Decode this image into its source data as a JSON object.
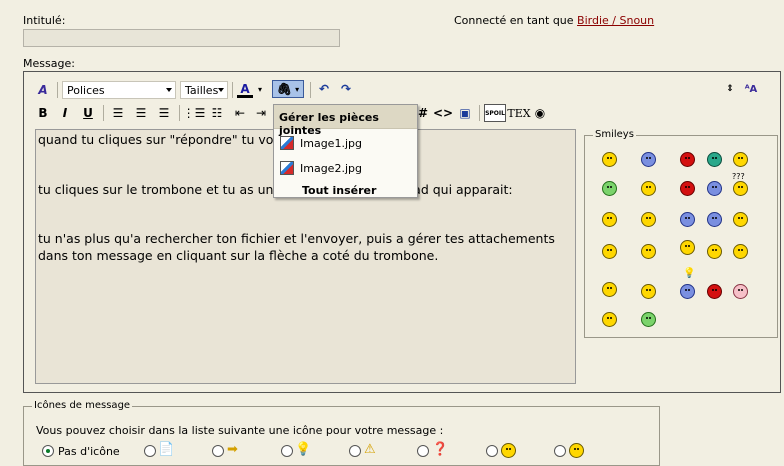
{
  "form": {
    "title_label": "Intitulé:",
    "message_label": "Message:",
    "title_value": ""
  },
  "header": {
    "connected_prefix": "Connecté en tant que",
    "user_link": "Birdie / Snoun"
  },
  "toolbar": {
    "font_select": "Polices",
    "size_select": "Tailles",
    "bold": "B",
    "italic": "I",
    "underline": "U",
    "code_label": "<>",
    "tex_label": "TEX",
    "spoil_label": "SPOIL"
  },
  "editor": {
    "lines": [
      "quand tu cliques sur \"répondre\" tu vo",
      "",
      "",
      "tu cliques sur le trombone et tu as une petite fenêtre d'upload qui apparait:",
      "",
      "",
      "tu n'as plus qu'a rechercher ton fichier et l'envoyer, puis a gérer tes attachements",
      "dans ton message en cliquant sur la flèche a coté du trombone."
    ]
  },
  "attachments_menu": {
    "title": "Gérer les pièces jointes",
    "items": [
      "Image1.jpg",
      "Image2.jpg"
    ],
    "insert_all": "Tout insérer"
  },
  "smileys": {
    "legend": "Smileys",
    "question_marks": "???"
  },
  "message_icons": {
    "legend": "Icônes de message",
    "description": "Vous pouvez choisir dans la liste suivante une icône pour votre message :",
    "none_label": "Pas d'icône"
  },
  "colors": {
    "background": "#f2efe2",
    "link": "#8b0000",
    "menu_header": "#ddd8c4"
  }
}
